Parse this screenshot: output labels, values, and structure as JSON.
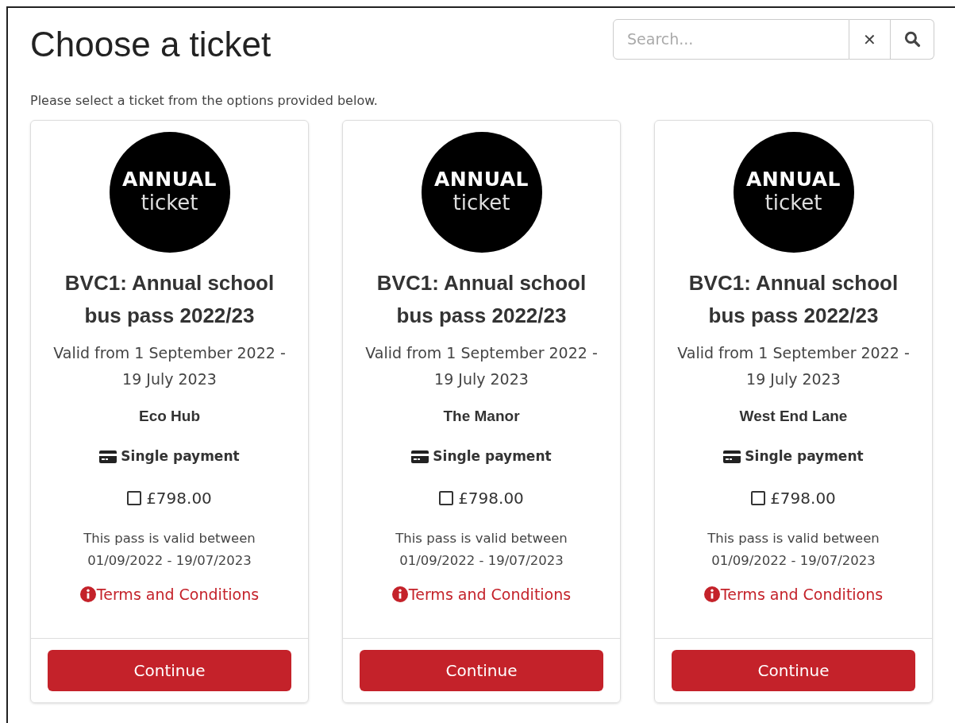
{
  "page": {
    "title": "Choose a ticket",
    "subtitle": "Please select a ticket from the options provided below."
  },
  "search": {
    "placeholder": "Search...",
    "clear_label": "✕"
  },
  "tickets": [
    {
      "logo_top": "ANNUAL",
      "logo_bottom": "ticket",
      "title": "BVC1: Annual school bus pass 2022/23",
      "validity": "Valid from 1 September 2022 - 19 July 2023",
      "location": "Eco Hub",
      "payment": "Single payment",
      "price": "£798.00",
      "checked": false,
      "pass_note": "This pass is valid between 01/09/2022 - 19/07/2023",
      "terms": "Terms and Conditions",
      "button": "Continue"
    },
    {
      "logo_top": "ANNUAL",
      "logo_bottom": "ticket",
      "title": "BVC1: Annual school bus pass 2022/23",
      "validity": "Valid from 1 September 2022 - 19 July 2023",
      "location": "The Manor",
      "payment": "Single payment",
      "price": "£798.00",
      "checked": false,
      "pass_note": "This pass is valid between 01/09/2022 - 19/07/2023",
      "terms": "Terms and Conditions",
      "button": "Continue"
    },
    {
      "logo_top": "ANNUAL",
      "logo_bottom": "ticket",
      "title": "BVC1: Annual school bus pass 2022/23",
      "validity": "Valid from 1 September 2022 - 19 July 2023",
      "location": "West End Lane",
      "payment": "Single payment",
      "price": "£798.00",
      "checked": false,
      "pass_note": "This pass is valid between 01/09/2022 - 19/07/2023",
      "terms": "Terms and Conditions",
      "button": "Continue"
    }
  ]
}
